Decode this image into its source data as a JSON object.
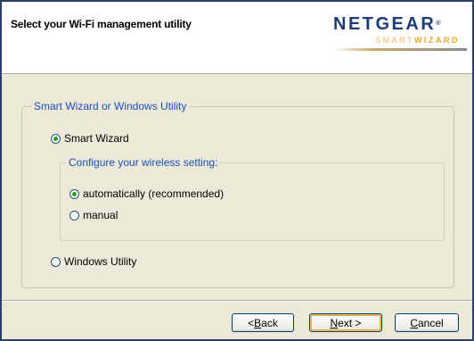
{
  "header": {
    "title": "Select your Wi-Fi management utility",
    "logo_main": "NETGEAR",
    "logo_mark": "®",
    "logo_sub_light": "SMART",
    "logo_sub_bold": "WIZARD"
  },
  "group": {
    "legend": "Smart Wizard or Windows Utility",
    "options": [
      {
        "label": "Smart Wizard",
        "selected": true
      },
      {
        "label": "Windows Utility",
        "selected": false
      }
    ],
    "subgroup": {
      "legend": "Configure your wireless setting:",
      "options": [
        {
          "label": "automatically (recommended)",
          "selected": true
        },
        {
          "label": "manual",
          "selected": false
        }
      ]
    }
  },
  "buttons": {
    "back_prefix": "<",
    "back_mnemonic": "B",
    "back_rest": "ack",
    "next_mnemonic": "N",
    "next_rest": "ext >",
    "cancel_mnemonic": "C",
    "cancel_rest": "ancel"
  },
  "colors": {
    "accent": "#1c4fb8",
    "selected_dot": "#21a121",
    "logo_navy": "#1e3c78",
    "logo_orange": "#f2a22b"
  }
}
